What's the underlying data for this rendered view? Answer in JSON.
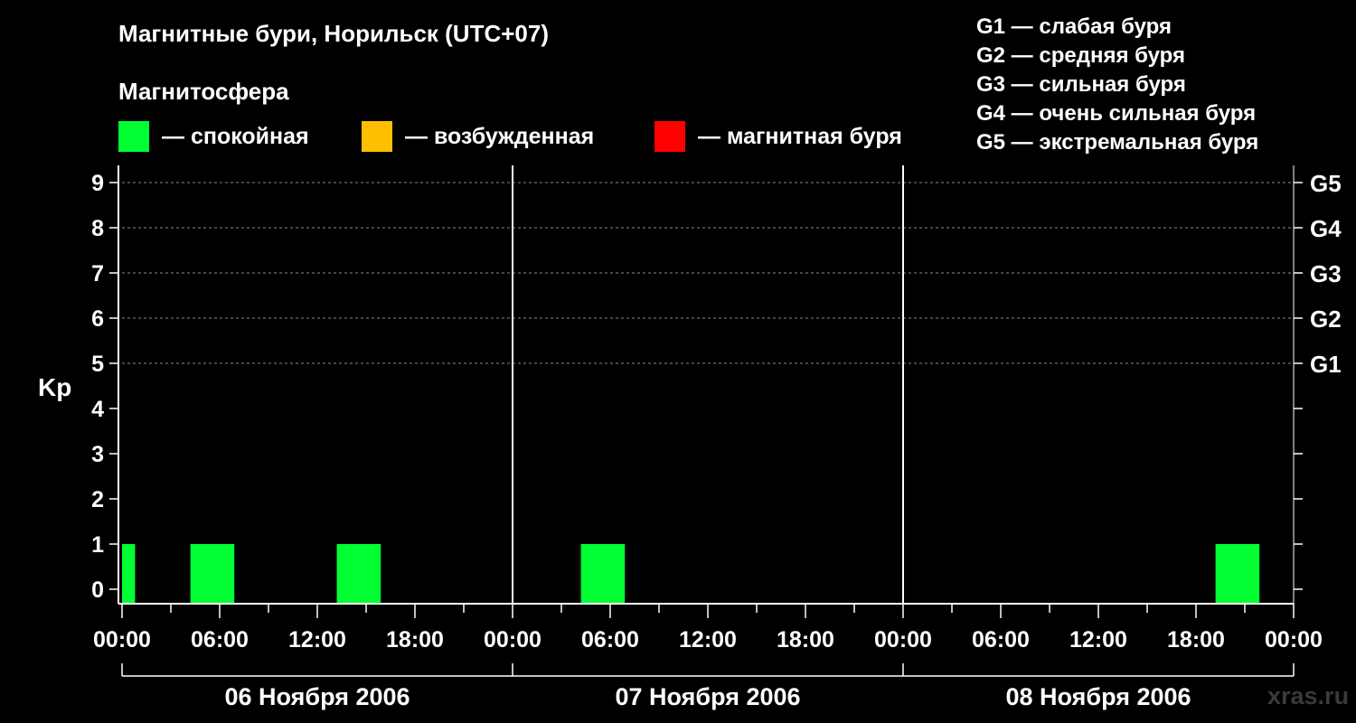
{
  "title": "Магнитные бури, Норильск (UTC+07)",
  "subtitle": "Магнитосфера",
  "legend": [
    {
      "color": "#00ff33",
      "label": "— спокойная"
    },
    {
      "color": "#ffbf00",
      "label": "— возбужденная"
    },
    {
      "color": "#ff0000",
      "label": "— магнитная буря"
    }
  ],
  "g_legend": [
    "G1 — слабая буря",
    "G2 — средняя буря",
    "G3 — сильная буря",
    "G4 — очень сильная буря",
    "G5 — экстремальная буря"
  ],
  "watermark": "xras.ru",
  "chart_data": {
    "type": "bar",
    "ylabel": "Kp",
    "ylim": [
      0,
      9
    ],
    "y_ticks": [
      "0",
      "1",
      "2",
      "3",
      "4",
      "5",
      "6",
      "7",
      "8",
      "9"
    ],
    "right_ticks": [
      {
        "y": 5,
        "label": "G1"
      },
      {
        "y": 6,
        "label": "G2"
      },
      {
        "y": 7,
        "label": "G3"
      },
      {
        "y": 8,
        "label": "G4"
      },
      {
        "y": 9,
        "label": "G5"
      }
    ],
    "grid": "dashed horizontal lines at Kp 5-9",
    "x_range_hours": [
      0,
      72
    ],
    "x_tick_labels": [
      "00:00",
      "06:00",
      "12:00",
      "18:00",
      "00:00",
      "06:00",
      "12:00",
      "18:00",
      "00:00",
      "06:00",
      "12:00",
      "18:00",
      "00:00"
    ],
    "days": [
      "06 Ноября 2006",
      "07 Ноября 2006",
      "08 Ноября 2006"
    ],
    "bars": [
      {
        "start_hour": 0,
        "end_hour": 0.8,
        "kp": 1,
        "level": "quiet"
      },
      {
        "start_hour": 4.2,
        "end_hour": 6.9,
        "kp": 1,
        "level": "quiet"
      },
      {
        "start_hour": 13.2,
        "end_hour": 15.9,
        "kp": 1,
        "level": "quiet"
      },
      {
        "start_hour": 28.2,
        "end_hour": 30.9,
        "kp": 1,
        "level": "quiet"
      },
      {
        "start_hour": 67.2,
        "end_hour": 69.9,
        "kp": 1,
        "level": "quiet"
      }
    ]
  }
}
